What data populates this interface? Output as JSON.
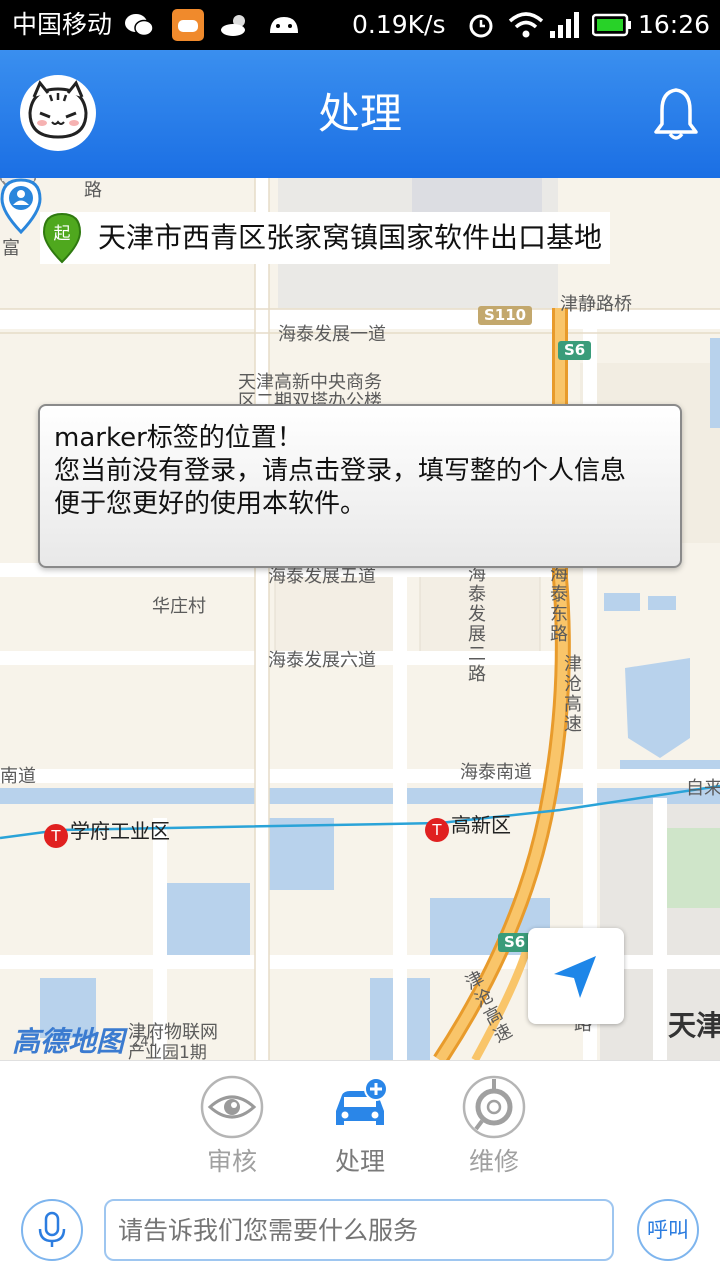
{
  "status_bar": {
    "carrier": "中国移动",
    "net_speed": "0.19K/s",
    "time": "16:26",
    "icons": [
      "wechat-icon",
      "game-icon",
      "weather-icon",
      "android-icon",
      "alarm-icon",
      "wifi-icon",
      "signal-icon",
      "battery-icon"
    ]
  },
  "header": {
    "title": "处理",
    "avatar_icon": "cat-avatar",
    "bell_icon": "bell-icon"
  },
  "map": {
    "start_label": "起",
    "start_address": "天津市西青区张家窝镇国家软件出口基地",
    "info_bubble": {
      "line1": "marker标签的位置！",
      "line2": "您当前没有登录，请点击登录，填写整的个人信息",
      "line3": "便于您更好的使用本软件。"
    },
    "labels": {
      "road_top": "路",
      "fu": "富",
      "jinjing_bridge": "津静路桥",
      "haitai_1": "海泰发展一道",
      "cbd_1": "天津高新中央商务",
      "cbd_2": "区二期双塔办公楼",
      "huazhuang": "华庄村",
      "haitai_5": "海泰发展五道",
      "haitai_6": "海泰发展六道",
      "haitai_2rd": "海泰发展二路",
      "haitai_east": "海泰东路",
      "jincang": "津沧高速",
      "haitai_south": "海泰南道",
      "nandao": "南道",
      "zilai": "自来",
      "jincang_2": "津沧高速",
      "wulian_1": "津府物联网",
      "wulian_2": "产业园1期",
      "tianjin": "天津",
      "lu_small": "路",
      "num_241": "241"
    },
    "road_numbers": {
      "s110": "S110",
      "s6_top": "S6",
      "s6_bottom": "S6"
    },
    "metro": {
      "xuefu": "学府工业区",
      "gaoxin": "高新区",
      "icon_glyph": "T"
    },
    "logo": "高德地图"
  },
  "tabs": [
    {
      "label": "审核",
      "icon": "eye-icon"
    },
    {
      "label": "处理",
      "icon": "car-add-icon"
    },
    {
      "label": "维修",
      "icon": "repair-icon"
    }
  ],
  "input": {
    "placeholder": "请告诉我们您需要什么服务",
    "call_label": "呼叫"
  },
  "colors": {
    "header_blue": "#1f74e6",
    "accent_blue": "#2c7de0",
    "map_bg": "#f7f3ea",
    "road_orange": "#f5a623",
    "water": "#b8d2ec"
  }
}
